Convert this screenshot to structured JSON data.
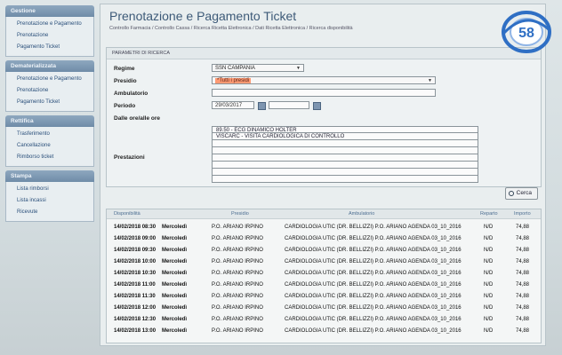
{
  "sidebar": {
    "sections": [
      {
        "title": "Gestione",
        "items": [
          "Prenotazione e Pagamento",
          "Prenotazione",
          "Pagamento Ticket"
        ]
      },
      {
        "title": "Dematerializzata",
        "items": [
          "Prenotazione e Pagamento",
          "Prenotazione",
          "Pagamento Ticket"
        ]
      },
      {
        "title": "Rettifica",
        "items": [
          "Trasferimento",
          "Cancellazione",
          "Rimborso ticket"
        ]
      },
      {
        "title": "Stampa",
        "items": [
          "Lista rimborsi",
          "Lista incassi",
          "Ricevute"
        ]
      }
    ]
  },
  "header": {
    "title": "Prenotazione e Pagamento Ticket",
    "breadcrumb": "Controllo Farmacia / Controllo Cassa / Ricerca Ricetta Elettronica / Dati Ricetta Elettronica / Ricerca disponibilità"
  },
  "params": {
    "heading": "PARAMETRI DI RICERCA",
    "regime_label": "Regime",
    "regime_value": "SSN CAMPANIA",
    "presidio_label": "Presidio",
    "presidio_value": "*Tutti i presidi",
    "ambulatorio_label": "Ambulatorio",
    "periodo_label": "Periodo",
    "periodo_value": "29/03/2017",
    "dalle_label": "Dalle ore/alle ore",
    "prestazioni_label": "Prestazioni",
    "prestazioni": [
      "89.50 - ECG DINAMICO HOLTER",
      "VISCARC - VISITA CARDIOLOGICA DI CONTROLLO",
      "",
      "",
      "",
      "",
      "",
      ""
    ]
  },
  "search_button": "Cerca",
  "table": {
    "headers": [
      "Disponibilità",
      "Presidio",
      "Ambulatorio",
      "Reparto",
      "Importo"
    ],
    "rows": [
      {
        "date": "14/02/2018 08:30",
        "day": "Mercoledì",
        "presidio": "P.O. ARIANO IRPINO",
        "ambulatorio": "CARDIOLOGIA UTIC (DR. BELLIZZI) P.O. ARIANO AGENDA 03_10_2016",
        "reparto": "N/D",
        "importo": "74,88"
      },
      {
        "date": "14/02/2018 09:00",
        "day": "Mercoledì",
        "presidio": "P.O. ARIANO IRPINO",
        "ambulatorio": "CARDIOLOGIA UTIC (DR. BELLIZZI) P.O. ARIANO AGENDA 03_10_2016",
        "reparto": "N/D",
        "importo": "74,88"
      },
      {
        "date": "14/02/2018 09:30",
        "day": "Mercoledì",
        "presidio": "P.O. ARIANO IRPINO",
        "ambulatorio": "CARDIOLOGIA UTIC (DR. BELLIZZI) P.O. ARIANO AGENDA 03_10_2016",
        "reparto": "N/D",
        "importo": "74,88"
      },
      {
        "date": "14/02/2018 10:00",
        "day": "Mercoledì",
        "presidio": "P.O. ARIANO IRPINO",
        "ambulatorio": "CARDIOLOGIA UTIC (DR. BELLIZZI) P.O. ARIANO AGENDA 03_10_2016",
        "reparto": "N/D",
        "importo": "74,88"
      },
      {
        "date": "14/02/2018 10:30",
        "day": "Mercoledì",
        "presidio": "P.O. ARIANO IRPINO",
        "ambulatorio": "CARDIOLOGIA UTIC (DR. BELLIZZI) P.O. ARIANO AGENDA 03_10_2016",
        "reparto": "N/D",
        "importo": "74,88"
      },
      {
        "date": "14/02/2018 11:00",
        "day": "Mercoledì",
        "presidio": "P.O. ARIANO IRPINO",
        "ambulatorio": "CARDIOLOGIA UTIC (DR. BELLIZZI) P.O. ARIANO AGENDA 03_10_2016",
        "reparto": "N/D",
        "importo": "74,88"
      },
      {
        "date": "14/02/2018 11:30",
        "day": "Mercoledì",
        "presidio": "P.O. ARIANO IRPINO",
        "ambulatorio": "CARDIOLOGIA UTIC (DR. BELLIZZI) P.O. ARIANO AGENDA 03_10_2016",
        "reparto": "N/D",
        "importo": "74,88"
      },
      {
        "date": "14/02/2018 12:00",
        "day": "Mercoledì",
        "presidio": "P.O. ARIANO IRPINO",
        "ambulatorio": "CARDIOLOGIA UTIC (DR. BELLIZZI) P.O. ARIANO AGENDA 03_10_2016",
        "reparto": "N/D",
        "importo": "74,88"
      },
      {
        "date": "14/02/2018 12:30",
        "day": "Mercoledì",
        "presidio": "P.O. ARIANO IRPINO",
        "ambulatorio": "CARDIOLOGIA UTIC (DR. BELLIZZI) P.O. ARIANO AGENDA 03_10_2016",
        "reparto": "N/D",
        "importo": "74,88"
      },
      {
        "date": "14/02/2018 13:00",
        "day": "Mercoledì",
        "presidio": "P.O. ARIANO IRPINO",
        "ambulatorio": "CARDIOLOGIA UTIC (DR. BELLIZZI) P.O. ARIANO AGENDA 03_10_2016",
        "reparto": "N/D",
        "importo": "74,88"
      }
    ]
  },
  "logo": {
    "text": "58",
    "color": "#2f6fc4"
  },
  "colors": {
    "presidio_highlight": "#ff9a73",
    "section_header": "#7a95b0",
    "title": "#3d5a78"
  }
}
